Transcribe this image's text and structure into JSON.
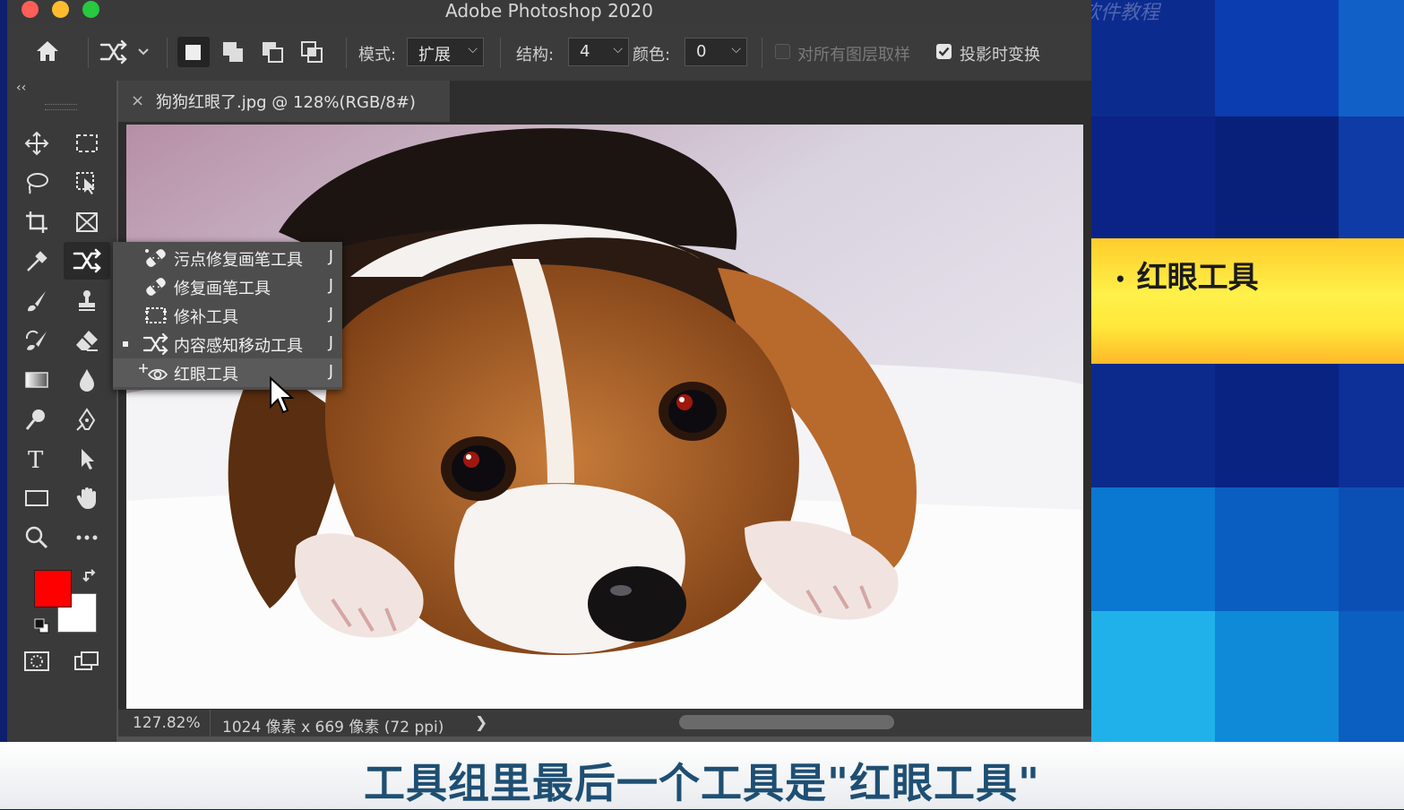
{
  "window": {
    "title": "Adobe Photoshop 2020"
  },
  "options_bar": {
    "mode_label": "模式:",
    "mode_value": "扩展",
    "structure_label": "结构:",
    "structure_value": "4",
    "color_label": "颜色:",
    "color_value": "0",
    "sample_all_layers": "对所有图层取样",
    "transform_on_drop": "投影时变换"
  },
  "toolbox": {
    "collapse": "‹‹"
  },
  "document": {
    "tab_title": "狗狗红眼了.jpg @ 128%(RGB/8#)",
    "close": "×"
  },
  "status": {
    "zoom": "127.82%",
    "info": "1024 像素 x 669 像素 (72 ppi)",
    "arrow": "❯"
  },
  "flyout_menu": {
    "items": [
      {
        "label": "污点修复画笔工具",
        "shortcut": "J",
        "icon": "spot-healing-brush-icon"
      },
      {
        "label": "修复画笔工具",
        "shortcut": "J",
        "icon": "healing-brush-icon"
      },
      {
        "label": "修补工具",
        "shortcut": "J",
        "icon": "patch-icon"
      },
      {
        "label": "内容感知移动工具",
        "shortcut": "J",
        "icon": "content-aware-move-icon",
        "current": true
      },
      {
        "label": "红眼工具",
        "shortcut": "J",
        "icon": "red-eye-icon",
        "hovered": true
      }
    ]
  },
  "colors": {
    "foreground": "#ff0000",
    "background": "#ffffff"
  },
  "side_banner": {
    "text": "红眼工具"
  },
  "watermark": "软件教程",
  "subtitle": "工具组里最后一个工具是\"红眼工具\""
}
